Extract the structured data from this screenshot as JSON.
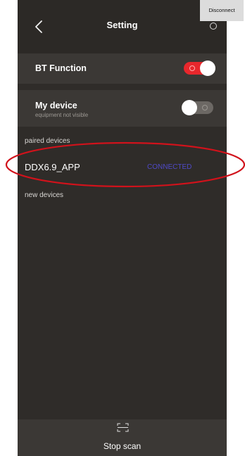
{
  "header": {
    "title": "Setting",
    "back_icon": "chevron-left-icon",
    "status_icon": "loading-spinner-icon"
  },
  "settings": {
    "bt_function": {
      "label": "BT Function",
      "enabled": true,
      "accent_color": "#e8272c"
    },
    "my_device": {
      "label": "My device",
      "subtitle": "equipment not visible",
      "enabled": false
    }
  },
  "paired_devices": {
    "label": "paired devices",
    "items": [
      {
        "name": "DDX6.9_APP",
        "status": "CONNECTED",
        "status_color": "#4f49c7",
        "action_label": "Disconnect"
      }
    ]
  },
  "new_devices": {
    "label": "new devices",
    "items": []
  },
  "footer": {
    "scan_icon": "scan-icon",
    "label": "Stop scan"
  },
  "annotation": {
    "color": "#d1121b",
    "shape": "ellipse"
  }
}
